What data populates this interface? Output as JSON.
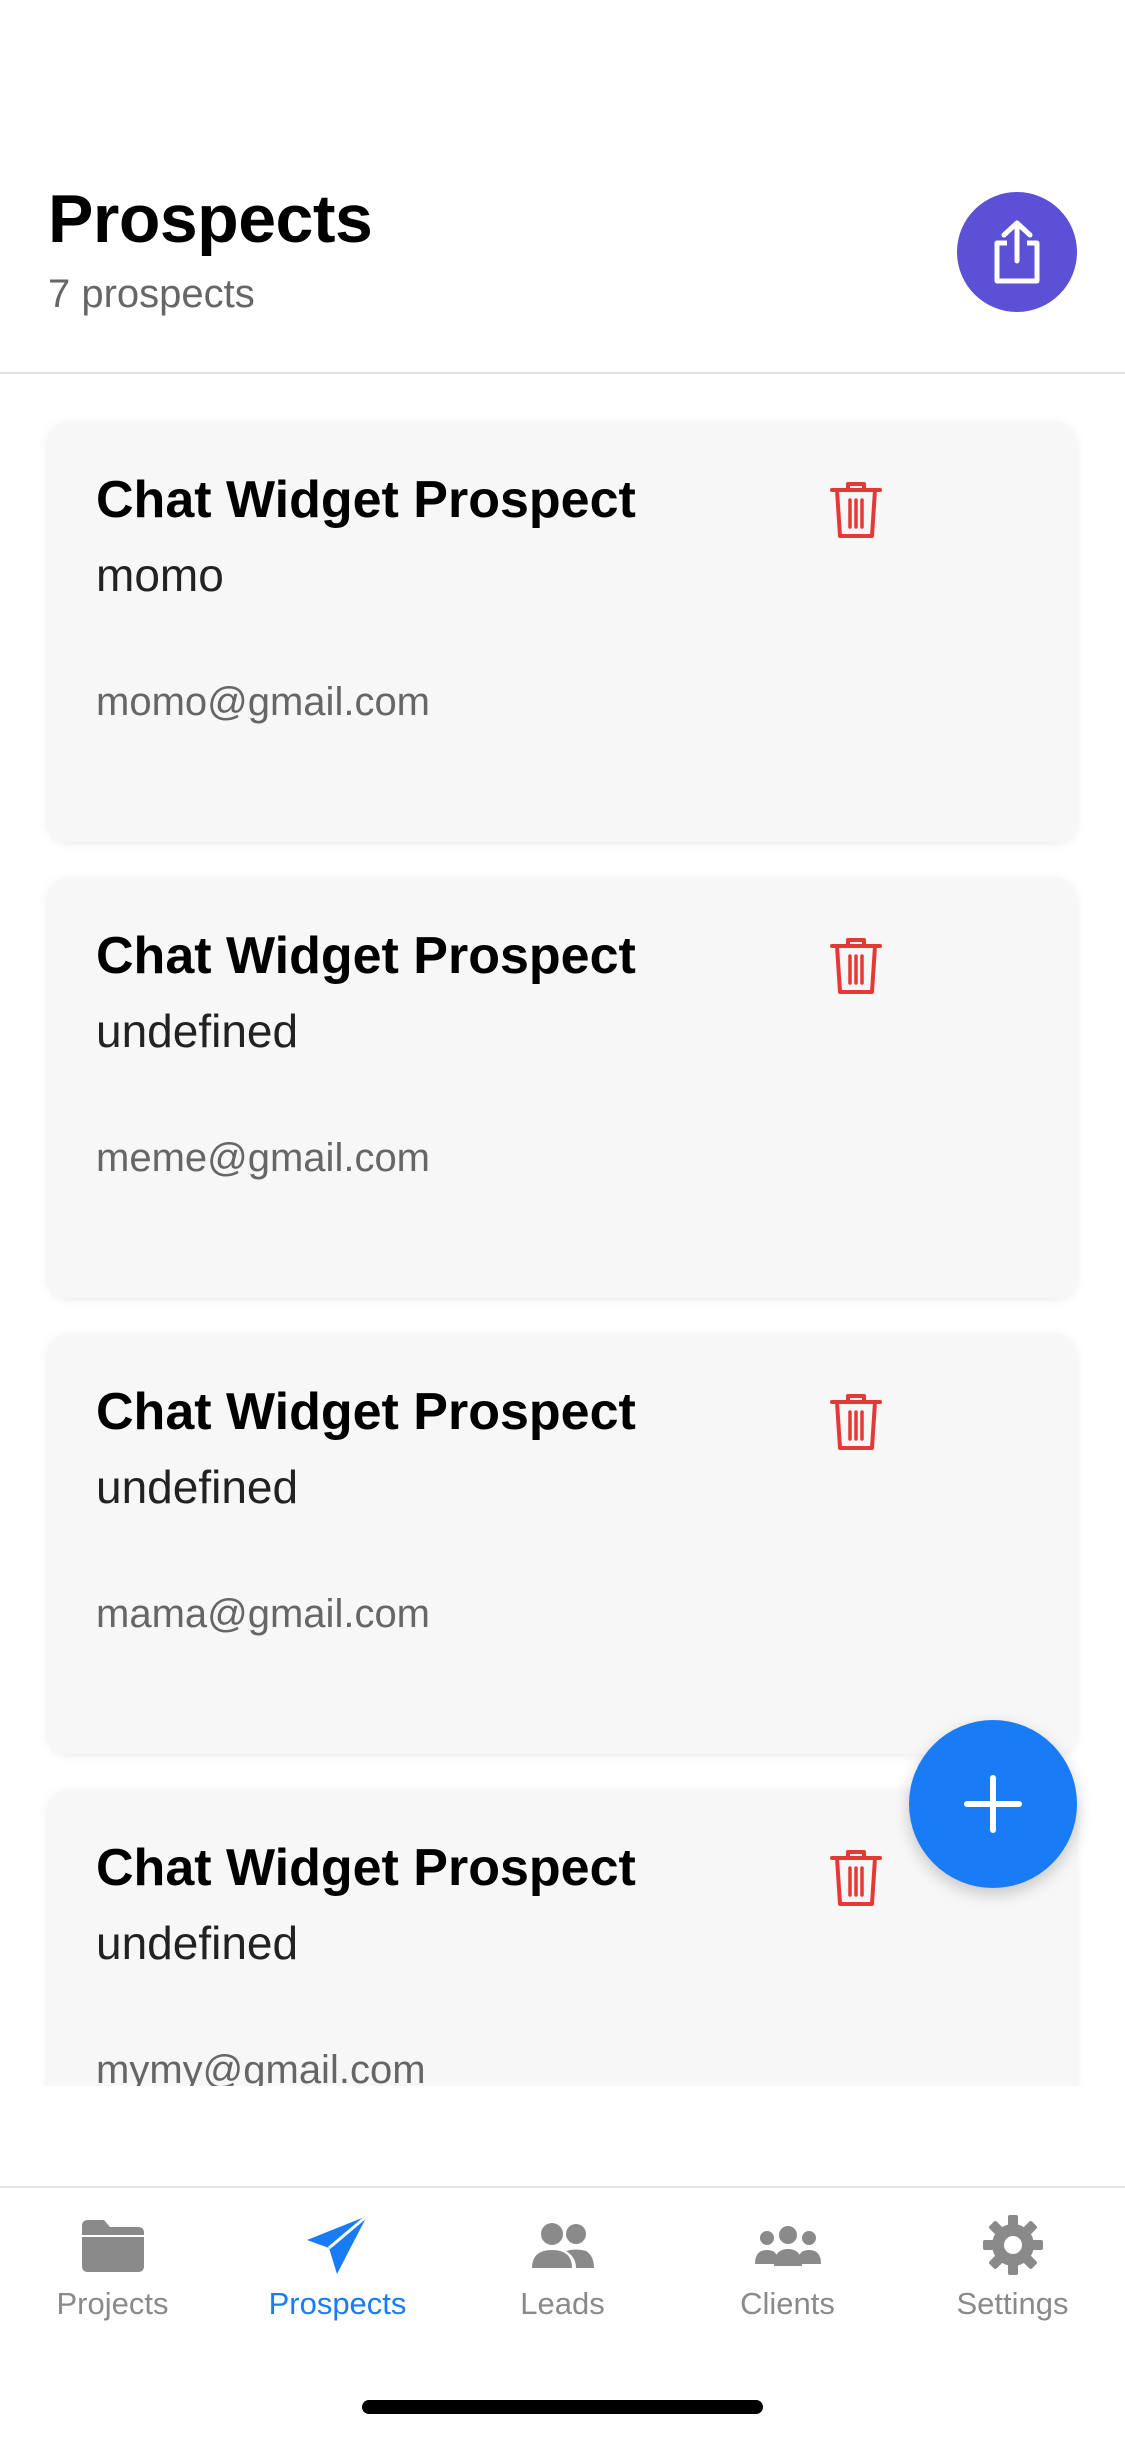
{
  "header": {
    "title": "Prospects",
    "subtitle": "7 prospects",
    "share_icon": "share-icon"
  },
  "prospects": [
    {
      "title": "Chat Widget Prospect",
      "name": "momo",
      "email": "momo@gmail.com"
    },
    {
      "title": "Chat Widget Prospect",
      "name": "undefined",
      "email": "meme@gmail.com"
    },
    {
      "title": "Chat Widget Prospect",
      "name": "undefined",
      "email": "mama@gmail.com"
    },
    {
      "title": "Chat Widget Prospect",
      "name": "undefined",
      "email": "mymy@gmail.com"
    }
  ],
  "fab": {
    "icon": "plus-icon"
  },
  "tabs": [
    {
      "label": "Projects",
      "icon": "folder-icon",
      "active": false
    },
    {
      "label": "Prospects",
      "icon": "paper-plane-icon",
      "active": true
    },
    {
      "label": "Leads",
      "icon": "users-icon",
      "active": false
    },
    {
      "label": "Clients",
      "icon": "group-icon",
      "active": false
    },
    {
      "label": "Settings",
      "icon": "gear-icon",
      "active": false
    }
  ],
  "colors": {
    "accent": "#1a7cf5",
    "share_button": "#5b50d6",
    "delete": "#e53935",
    "inactive_tab": "#8a8a8a"
  }
}
